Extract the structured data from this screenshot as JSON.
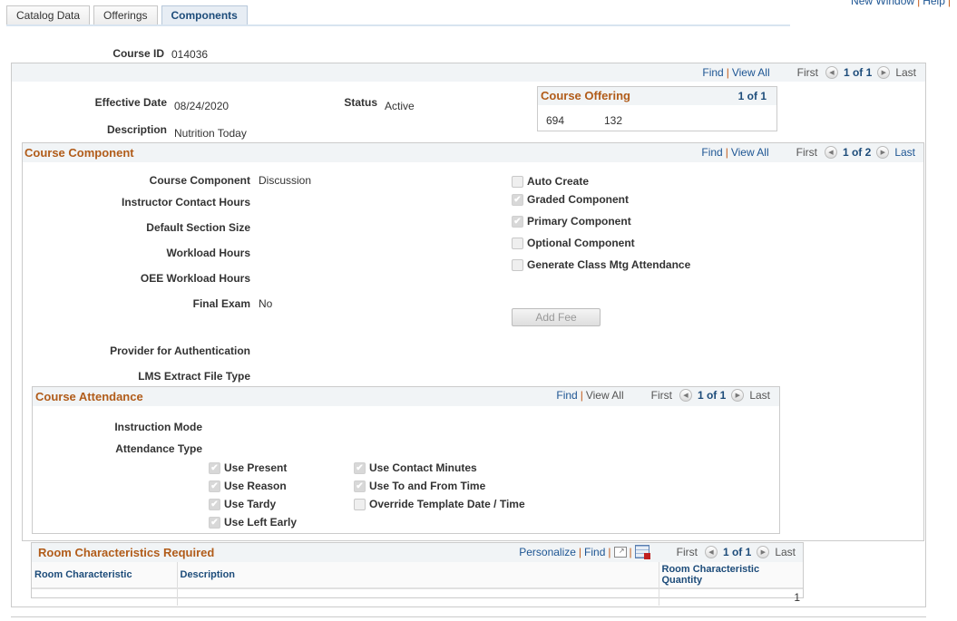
{
  "top_links": {
    "new_window": "New Window",
    "help": "Help"
  },
  "tabs": [
    {
      "label": "Catalog Data",
      "active": false
    },
    {
      "label": "Offerings",
      "active": false
    },
    {
      "label": "Components",
      "active": true
    }
  ],
  "course_id": {
    "label": "Course ID",
    "value": "014036"
  },
  "main_nav": {
    "find": "Find",
    "view_all": "View All",
    "first": "First",
    "count": "1 of 1",
    "last": "Last"
  },
  "effective_date": {
    "label": "Effective Date",
    "value": "08/24/2020"
  },
  "status": {
    "label": "Status",
    "value": "Active"
  },
  "description": {
    "label": "Description",
    "value": "Nutrition Today"
  },
  "course_offering": {
    "title": "Course Offering",
    "count": "1 of 1",
    "values": [
      "694",
      "132"
    ]
  },
  "course_component": {
    "title": "Course Component",
    "nav": {
      "find": "Find",
      "view_all": "View All",
      "first": "First",
      "count": "1 of 2",
      "last": "Last"
    },
    "fields": [
      {
        "label": "Course Component",
        "value": "Discussion"
      },
      {
        "label": "Instructor Contact Hours",
        "value": ""
      },
      {
        "label": "Default Section Size",
        "value": ""
      },
      {
        "label": "Workload Hours",
        "value": ""
      },
      {
        "label": "OEE Workload Hours",
        "value": ""
      },
      {
        "label": "Final Exam",
        "value": "No"
      },
      {
        "label": "Provider for Authentication",
        "value": ""
      },
      {
        "label": "LMS Extract File Type",
        "value": ""
      }
    ],
    "checkboxes": [
      {
        "label": "Auto Create",
        "checked": false
      },
      {
        "label": "Graded Component",
        "checked": true
      },
      {
        "label": "Primary Component",
        "checked": true
      },
      {
        "label": "Optional Component",
        "checked": false
      },
      {
        "label": "Generate Class Mtg Attendance",
        "checked": false
      }
    ],
    "add_fee_label": "Add Fee"
  },
  "course_attendance": {
    "title": "Course Attendance",
    "nav": {
      "find": "Find",
      "view_all": "View All",
      "first": "First",
      "count": "1 of 1",
      "last": "Last"
    },
    "instruction_mode_label": "Instruction Mode",
    "attendance_type_label": "Attendance Type",
    "col1": [
      {
        "label": "Use Present",
        "checked": true
      },
      {
        "label": "Use Reason",
        "checked": true
      },
      {
        "label": "Use Tardy",
        "checked": true
      },
      {
        "label": "Use Left Early",
        "checked": true
      }
    ],
    "col2": [
      {
        "label": "Use Contact Minutes",
        "checked": true
      },
      {
        "label": "Use To and From Time",
        "checked": true
      },
      {
        "label": "Override Template Date / Time",
        "checked": false
      }
    ]
  },
  "room_characteristics": {
    "title": "Room Characteristics Required",
    "nav": {
      "personalize": "Personalize",
      "find": "Find",
      "first": "First",
      "count": "1 of 1",
      "last": "Last"
    },
    "columns": [
      "Room Characteristic",
      "Description",
      "Room Characteristic Quantity"
    ],
    "rows": [
      [
        "",
        "",
        "1"
      ]
    ]
  }
}
